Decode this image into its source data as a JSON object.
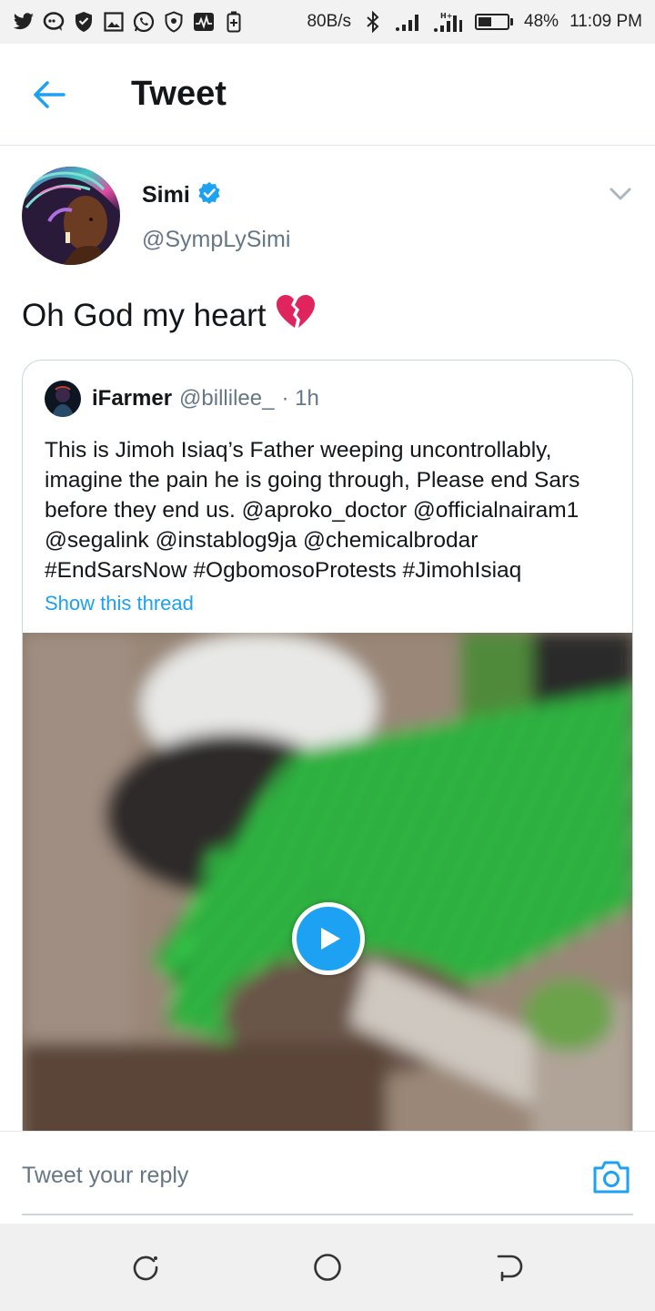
{
  "status_bar": {
    "left_icons": [
      "twitter-icon",
      "chat-bubble-icon",
      "shield-icon",
      "image-icon",
      "whatsapp-icon",
      "shield-outline-icon",
      "pulse-icon",
      "battery-saver-icon"
    ],
    "network_speed": "80B/s",
    "battery_percent": "48%",
    "battery_level": 0.48,
    "time": "11:09 PM"
  },
  "header": {
    "back_icon": "arrow-left-icon",
    "title": "Tweet"
  },
  "tweet": {
    "author_name": "Simi",
    "verified": true,
    "author_handle": "@SympLySimi",
    "text": "Oh God my heart",
    "emoji": "💔"
  },
  "quote": {
    "author_name": "iFarmer",
    "author_handle": "@billilee_",
    "time": "· 1h",
    "text": "This is Jimoh Isiaq’s Father weeping uncontrollably,\nimagine the pain he is going through, Please end Sars\nbefore they end us. @aproko_doctor @officialnairam1\n@segalink @instablog9ja @chemicalbrodar\n#EndSarsNow #OgbomosoProtests #JimohIsiaq",
    "show_thread": "Show this thread"
  },
  "reply": {
    "placeholder": "Tweet your reply"
  },
  "colors": {
    "accent": "#1da1f2",
    "text": "#14171a",
    "secondary": "#657786"
  }
}
